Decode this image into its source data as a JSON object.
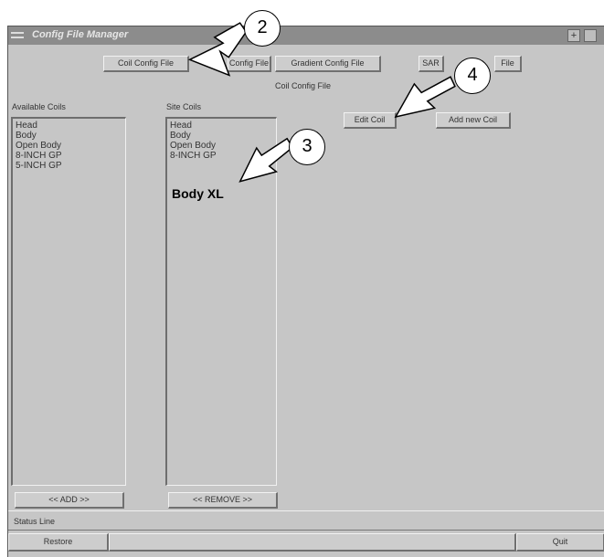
{
  "window": {
    "title": "Config File Manager"
  },
  "tabs": [
    "Coil Config File",
    "Config File",
    "Gradient Config File",
    "SAR",
    "File"
  ],
  "section_title": "Coil Config File",
  "available": {
    "label": "Available Coils",
    "items": [
      "Head",
      "Body",
      "Open Body",
      "8-INCH GP",
      "5-INCH GP"
    ]
  },
  "site": {
    "label": "Site Coils",
    "items": [
      "Head",
      "Body",
      "Open Body",
      "8-INCH GP"
    ]
  },
  "buttons": {
    "edit_coil": "Edit Coil",
    "add_new_coil": "Add new Coil",
    "add": "<< ADD >>",
    "remove": "<< REMOVE >>",
    "restore": "Restore",
    "quit": "Quit"
  },
  "status_line": "Status Line",
  "annotation_text": "Body XL",
  "callouts": [
    "2",
    "3",
    "4"
  ]
}
